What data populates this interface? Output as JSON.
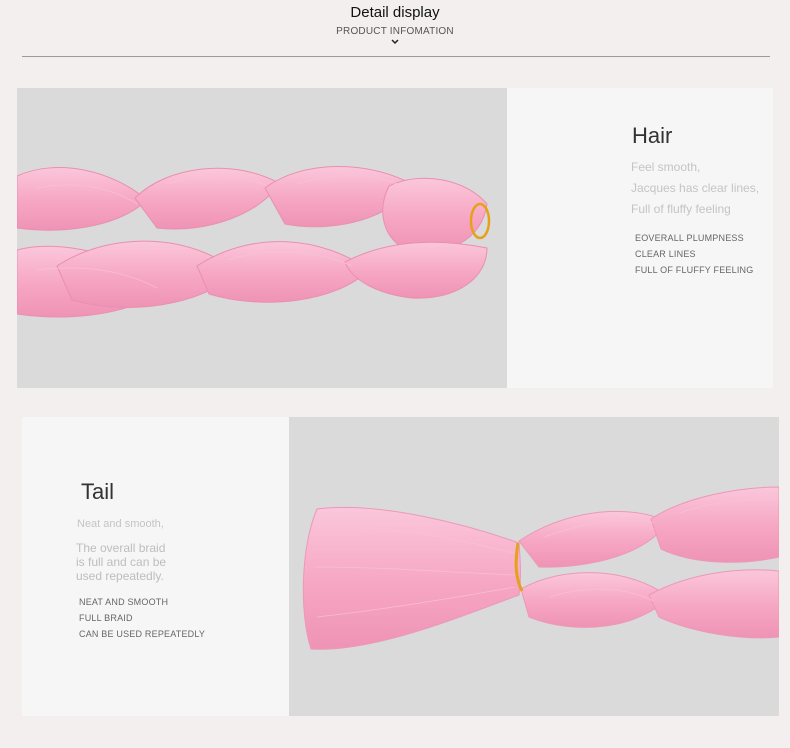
{
  "header": {
    "title": "Detail display",
    "subtitle": "PRODUCT INFOMATION",
    "chevron_icon": "chevron-down-icon"
  },
  "colors": {
    "page_bg": "#f3efef",
    "panel_bg": "#f6f6f6",
    "photo_bg": "#dadada",
    "braid_pink": "#f7a8c4",
    "band_color": "#e6a11c"
  },
  "hair": {
    "heading": "Hair",
    "lines": [
      "Feel smooth,",
      "Jacques has clear lines,",
      "Full of fluffy feeling"
    ],
    "caps": [
      "EOVERALL PLUMPNESS",
      "CLEAR LINES",
      "FULL OF FLUFFY FEELING"
    ]
  },
  "tail": {
    "heading": "Tail",
    "lines": [
      "Neat and smooth,"
    ],
    "lines2": [
      "The overall braid",
      "is full and can be",
      "used repeatedly."
    ],
    "caps": [
      "NEAT AND SMOOTH",
      "FULL BRAID",
      "CAN BE USED REPEATEDLY"
    ]
  }
}
